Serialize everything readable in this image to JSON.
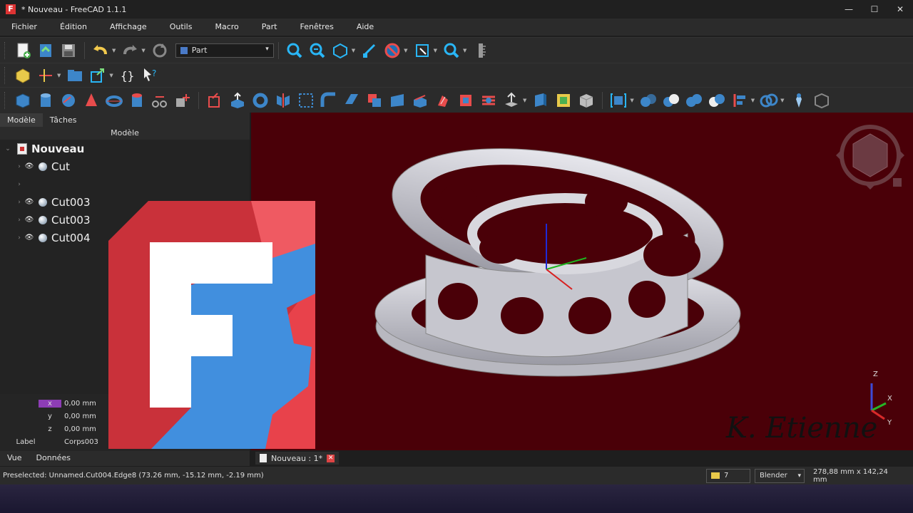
{
  "window": {
    "title": "* Nouveau - FreeCAD 1.1.1",
    "app_icon": "F",
    "controls": [
      "—",
      "☐",
      "✕"
    ]
  },
  "menu": {
    "items": [
      "Fichier",
      "Édition",
      "Affichage",
      "Outils",
      "Macro",
      "Part",
      "Fenêtres",
      "Aide"
    ]
  },
  "toolbar": {
    "workbench": "Part"
  },
  "left_panel": {
    "tabs": [
      "Modèle",
      "Tâches"
    ],
    "header": "Modèle",
    "tree": {
      "root": "Nouveau",
      "items": [
        "Cut",
        "",
        "Cut003",
        "Cut003",
        "Cut004"
      ]
    },
    "properties": {
      "rows": [
        {
          "name": "x",
          "value": "0,00 mm"
        },
        {
          "name": "y",
          "value": "0,00 mm"
        },
        {
          "name": "z",
          "value": "0,00 mm"
        },
        {
          "name": "Label",
          "value": "Corps003"
        }
      ]
    },
    "bottom_tabs": [
      "Vue",
      "Données"
    ]
  },
  "viewport": {
    "background": "#4a0008",
    "axis_labels": [
      "Z",
      "X",
      "Y"
    ]
  },
  "doc_tab": {
    "label": "Nouveau : 1*",
    "close": "✕"
  },
  "statusbar": {
    "preselected": "Preselected: Unnamed.Cut004.Edge8 (73.26 mm, -15.12 mm, -2.19 mm)",
    "count": "7",
    "nav_style": "Blender",
    "dimensions": "278,88 mm x 142,24 mm"
  },
  "overlay": {
    "signature": "K. Etienne"
  },
  "colors": {
    "accent": "#8d3db5",
    "logo_red": "#e8424b",
    "logo_blue": "#418fde"
  }
}
